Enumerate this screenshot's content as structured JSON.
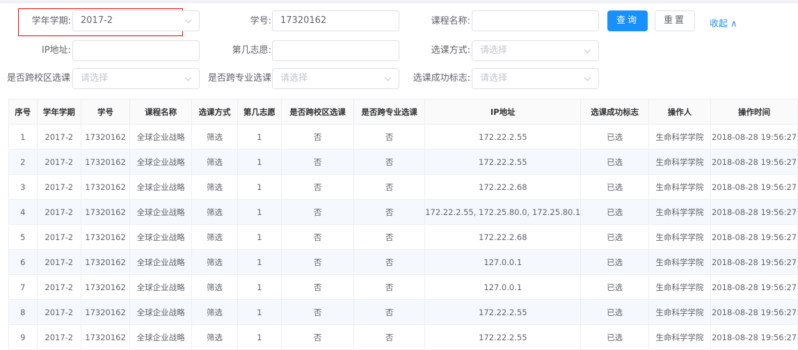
{
  "filters": {
    "term": {
      "label": "学年学期:",
      "value": "2017-2"
    },
    "student_id": {
      "label": "学号:",
      "value": "17320162"
    },
    "course_name": {
      "label": "课程名称:",
      "value": ""
    },
    "ip": {
      "label": "IP地址:",
      "value": ""
    },
    "preference": {
      "label": "第几志愿:",
      "value": ""
    },
    "method": {
      "label": "选课方式:",
      "placeholder": "请选择"
    },
    "cross_campus": {
      "label": "是否跨校区选课:",
      "placeholder": "请选择"
    },
    "cross_major": {
      "label": "是否跨专业选课:",
      "placeholder": "请选择"
    },
    "success_flag": {
      "label": "选课成功标志:",
      "placeholder": "请选择"
    }
  },
  "buttons": {
    "search": "查询",
    "reset": "重置",
    "collapse": "收起 ∧"
  },
  "colors": {
    "primary": "#1890ff",
    "highlight_border": "#ee0000"
  },
  "table": {
    "columns": [
      "序号",
      "学年学期",
      "学号",
      "课程名称",
      "选课方式",
      "第几志愿",
      "是否跨校区选课",
      "是否跨专业选课",
      "IP地址",
      "选课成功标志",
      "操作人",
      "操作时间"
    ],
    "rows": [
      [
        "1",
        "2017-2",
        "17320162",
        "全球企业战略",
        "筛选",
        "1",
        "否",
        "否",
        "172.22.2.55",
        "已选",
        "生命科学学院",
        "2018-08-28 19:56:27"
      ],
      [
        "2",
        "2017-2",
        "17320162",
        "全球企业战略",
        "筛选",
        "1",
        "否",
        "否",
        "172.22.2.55",
        "已选",
        "生命科学学院",
        "2018-08-28 19:56:27"
      ],
      [
        "3",
        "2017-2",
        "17320162",
        "全球企业战略",
        "筛选",
        "1",
        "否",
        "否",
        "172.22.2.68",
        "已选",
        "生命科学学院",
        "2018-08-28 19:56:27"
      ],
      [
        "4",
        "2017-2",
        "17320162",
        "全球企业战略",
        "筛选",
        "1",
        "否",
        "否",
        "172.22.2.55, 172.25.80.0, 172.25.80.1",
        "已选",
        "生命科学学院",
        "2018-08-28 19:56:27"
      ],
      [
        "5",
        "2017-2",
        "17320162",
        "全球企业战略",
        "筛选",
        "1",
        "否",
        "否",
        "172.22.2.68",
        "已选",
        "生命科学学院",
        "2018-08-28 19:56:27"
      ],
      [
        "6",
        "2017-2",
        "17320162",
        "全球企业战略",
        "筛选",
        "1",
        "否",
        "否",
        "127.0.0.1",
        "已选",
        "生命科学学院",
        "2018-08-28 19:56:27"
      ],
      [
        "7",
        "2017-2",
        "17320162",
        "全球企业战略",
        "筛选",
        "1",
        "否",
        "否",
        "127.0.0.1",
        "已选",
        "生命科学学院",
        "2018-08-28 19:56:27"
      ],
      [
        "8",
        "2017-2",
        "17320162",
        "全球企业战略",
        "筛选",
        "1",
        "否",
        "否",
        "172.22.2.55",
        "已选",
        "生命科学学院",
        "2018-08-28 19:56:27"
      ],
      [
        "9",
        "2017-2",
        "17320162",
        "全球企业战略",
        "筛选",
        "1",
        "否",
        "否",
        "172.22.2.55",
        "已选",
        "生命科学学院",
        "2018-08-28 19:56:27"
      ]
    ]
  }
}
